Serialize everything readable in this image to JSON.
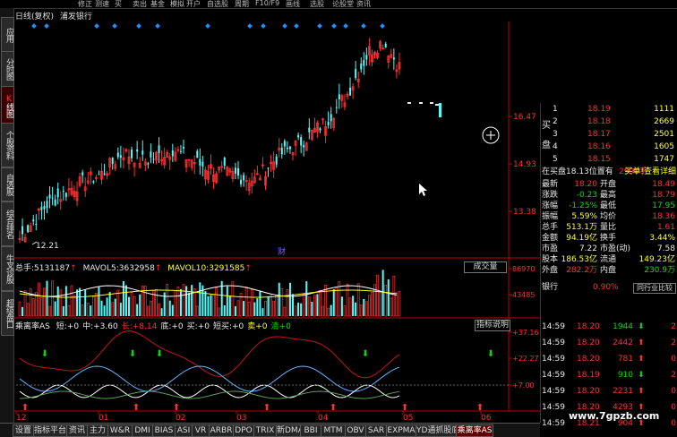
{
  "menubar": [
    "修正",
    "测速",
    "买",
    "卖出",
    "基金",
    "模拟",
    "开户",
    "自选股",
    "周期",
    "F10/F9",
    "画线",
    "选股",
    "论股堂",
    "资讯"
  ],
  "left_tabs": [
    "应用",
    "分时图",
    "K线图",
    "个股资料",
    "自选股",
    "综合排名",
    "牛叉诊股",
    "超级盘口"
  ],
  "header": {
    "title": "日线(复权)",
    "stock": "浦发银行"
  },
  "price_axis": {
    "ticks": [
      "16.47",
      "14.93",
      "13.38"
    ],
    "low_label": "12.21"
  },
  "volume": {
    "total_label": "总手:",
    "total": "5131187",
    "mavol5_label": "MAVOL5:",
    "mavol5": "3632958",
    "mavol10_label": "MAVOL10:",
    "mavol10": "3291585",
    "button": "成交量",
    "ticks": [
      "86970",
      "43485"
    ]
  },
  "indicator": {
    "name": "乘离率AS",
    "fields": [
      {
        "label": "短:",
        "value": "+0",
        "color": "#e8e8e8"
      },
      {
        "label": "中:",
        "value": "+3.60",
        "color": "#e8e8e8"
      },
      {
        "label": "长:",
        "value": "+8.14",
        "color": "#ff3030"
      },
      {
        "label": "底:",
        "value": "+0",
        "color": "#e8e8e8"
      },
      {
        "label": "买:",
        "value": "+0",
        "color": "#e8e8e8"
      },
      {
        "label": "短买:",
        "value": "+0",
        "color": "#e8e8e8"
      },
      {
        "label": "卖",
        "value": "+0",
        "color": "#ffff30"
      },
      {
        "label": "清",
        "value": "+0",
        "color": "#00e000"
      }
    ],
    "button": "指标说明",
    "ticks": [
      "+37.16",
      "+22.27",
      "+7.00"
    ]
  },
  "finance_marker": "财",
  "x_axis": [
    "12",
    "01",
    "02",
    "03",
    "04",
    "05",
    "06"
  ],
  "right_panel": {
    "buy_label": "买",
    "pan_label": "盘",
    "orders": [
      {
        "level": "1",
        "price": "18.19",
        "vol": "1111"
      },
      {
        "level": "2",
        "price": "18.18",
        "vol": "2669"
      },
      {
        "level": "3",
        "price": "18.17",
        "vol": "2501"
      },
      {
        "level": "4",
        "price": "18.16",
        "vol": "1605"
      },
      {
        "level": "5",
        "price": "18.15",
        "vol": "1747"
      }
    ],
    "buy1_text": "在买盘18.13位置有",
    "buy1_qty": "2990手",
    "buy1_link": "买单!查看详细",
    "quote_rows": [
      {
        "l1": "最新",
        "v1": "18.20",
        "c1": "red",
        "l2": "开盘",
        "v2": "18.49",
        "c2": "red"
      },
      {
        "l1": "涨跌",
        "v1": "-0.23",
        "c1": "green",
        "l2": "最高",
        "v2": "18.79",
        "c2": "red"
      },
      {
        "l1": "涨幅",
        "v1": "-1.25%",
        "c1": "green",
        "l2": "最低",
        "v2": "17.95",
        "c2": "green"
      },
      {
        "l1": "振幅",
        "v1": "5.59%",
        "c1": "yellow",
        "l2": "均价",
        "v2": "18.36",
        "c2": "red"
      },
      {
        "l1": "总手",
        "v1": "513.1万",
        "c1": "yellow",
        "l2": "量比",
        "v2": "1.61",
        "c2": "red"
      },
      {
        "l1": "金额",
        "v1": "94.19亿",
        "c1": "yellow",
        "l2": "换手",
        "v2": "3.44%",
        "c2": "yellow"
      },
      {
        "l1": "市盈",
        "v1": "7.22",
        "c1": "white",
        "l2": "市盈(动)",
        "v2": "7.58",
        "c2": "white"
      },
      {
        "l1": "股本",
        "v1": "186.53亿",
        "c1": "yellow",
        "l2": "流通",
        "v2": "149.23亿",
        "c2": "yellow"
      },
      {
        "l1": "外盘",
        "v1": "282.2万",
        "c1": "red",
        "l2": "内盘",
        "v2": "230.9万",
        "c2": "green"
      }
    ],
    "industry_name": "银行",
    "industry_pct": "0.90%",
    "industry_btn": "同行业比较",
    "ticks": [
      {
        "time": "14:59",
        "price": "18.20",
        "vol": "1944",
        "dir": "down"
      },
      {
        "time": "14:59",
        "price": "18.20",
        "vol": "2442",
        "dir": "up"
      },
      {
        "time": "14:59",
        "price": "18.20",
        "vol": "781",
        "dir": "up"
      },
      {
        "time": "14:59",
        "price": "18.19",
        "vol": "910",
        "dir": "down"
      },
      {
        "time": "14:59",
        "price": "18.20",
        "vol": "2231",
        "dir": "up"
      },
      {
        "time": "14:59",
        "price": "18.20",
        "vol": "4293",
        "dir": "up"
      },
      {
        "time": "14:59",
        "price": "18.21",
        "vol": "904",
        "dir": "up"
      }
    ],
    "right_edge_numbers": [
      "2",
      "2",
      "0",
      "2",
      "0",
      "0",
      "0"
    ]
  },
  "bottom_tabs": [
    "设置",
    "指标平台",
    "资讯",
    "主力",
    "W&R",
    "DMI",
    "BIAS",
    "ASI",
    "VR",
    "ARBR",
    "DPO",
    "TRIX",
    "新DMA",
    "BBI",
    "MTM",
    "OBV",
    "SAR",
    "EXPMA",
    "YD通抓股底",
    "乘离率AS"
  ],
  "watermark": "www.7gpzb.com"
}
